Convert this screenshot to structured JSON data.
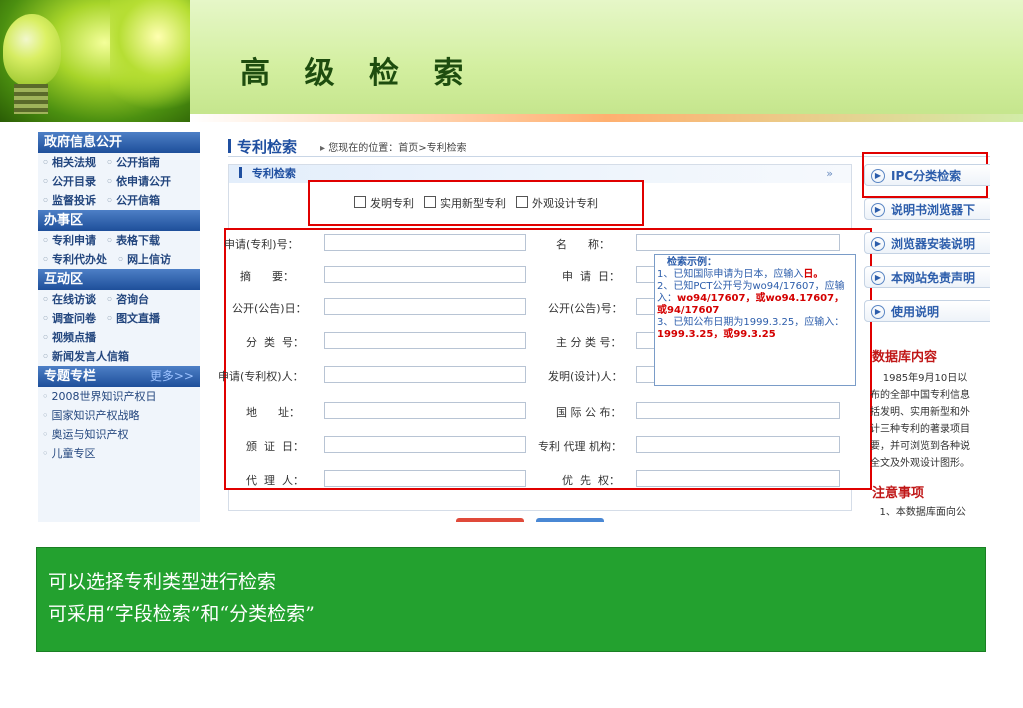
{
  "slide": {
    "title": "高 级 检 索",
    "notes": [
      "可以选择专利类型进行检索",
      "可采用“字段检索”和“分类检索”"
    ]
  },
  "sidebar": {
    "sections": [
      {
        "title": "政府信息公开",
        "rows": [
          [
            "相关法规",
            "公开指南"
          ],
          [
            "公开目录",
            "依申请公开"
          ],
          [
            "监督投诉",
            "公开信箱"
          ]
        ]
      },
      {
        "title": "办事区",
        "rows": [
          [
            "专利申请",
            "表格下载"
          ],
          [
            "专利代办处",
            "网上信访"
          ]
        ]
      },
      {
        "title": "互动区",
        "rows": [
          [
            "在线访谈",
            "咨询台"
          ],
          [
            "调查问卷",
            "图文直播"
          ],
          [
            "视频点播"
          ],
          [
            "新闻发言人信箱"
          ]
        ]
      },
      {
        "title": "专题专栏",
        "more": "更多>>",
        "rows": [
          [
            "2008世界知识产权日"
          ],
          [
            "国家知识产权战略"
          ],
          [
            "奥运与知识产权"
          ],
          [
            "儿童专区"
          ]
        ]
      }
    ]
  },
  "main": {
    "title": "专利检索",
    "breadcrumb": "您现在的位置：首页>专利检索",
    "panel_title": "专利检索",
    "panel_arrow": "»",
    "patent_types": [
      "发明专利",
      "实用新型专利",
      "外观设计专利"
    ],
    "left_fields": [
      "申请(专利)号：",
      "摘      要：",
      "公开(公告)日：",
      "分  类  号：",
      "申请(专利权)人：",
      "地      址：",
      "颁  证  日：",
      "代  理  人："
    ],
    "right_fields": [
      "名      称：",
      "申  请  日：",
      "公开(公告)号：",
      "主 分 类 号：",
      "发明(设计)人：",
      "国 际 公 布：",
      "专利 代理 机构：",
      "优  先  权："
    ],
    "example": {
      "title": "检索示例：",
      "line1": "1、已知国际申请为日本，应输入",
      "line1_red": "日。",
      "line2": "2、已知PCT公开号为wo94/17607，应输入：",
      "line2_red1": "wo94/17607",
      "line2_mid": "，或",
      "line2_red2": "wo94.17607",
      "line2_tail": "，或",
      "line2_red3": "94/17607",
      "line3": "3、已知公布日期为1999.3.25，应输入：",
      "line3_red1": "1999.3.25",
      "line3_mid": "，或",
      "line3_red2": "99.3.25"
    }
  },
  "right_links": [
    "IPC分类检索",
    "说明书浏览器下",
    "浏览器安装说明",
    "本网站免责声明",
    "使用说明"
  ],
  "db": {
    "heading": "数据库内容",
    "text": "    1985年9月10日以\n布的全部中国专利信息\n括发明、实用新型和外\n计三种专利的著录项目\n要，并可浏览到各种说\n全文及外观设计图形。",
    "notice_heading": "注意事项",
    "notice_text": "   1、本数据库面向公"
  }
}
